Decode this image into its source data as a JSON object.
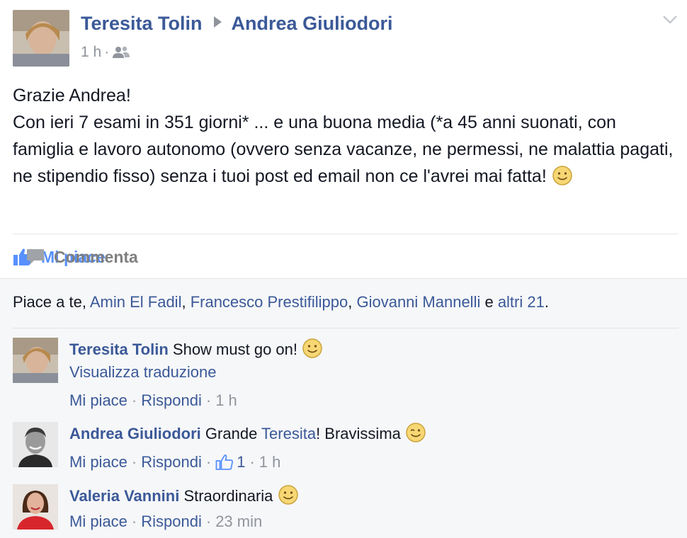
{
  "post": {
    "author": "Teresita Tolin",
    "target": "Andrea Giuliodori",
    "time": "1 h",
    "audience_icon": "friends-icon",
    "menu_icon": "chevron-down-icon",
    "paragraph_1": "Grazie Andrea!",
    "paragraph_2": "Con ieri 7 esami in 351 giorni* ... e una buona media (*a 45 anni suonati, con famiglia e lavoro autonomo (ovvero senza vacanze, ne permessi, ne malattia pagati, ne stipendio fisso) senza i tuoi post ed email non ce l'avrei mai fatta!",
    "emoji": "smile-emoji"
  },
  "actions": {
    "like_label": "Mi piace",
    "comment_label": "Commenta"
  },
  "likes": {
    "prefix": "Piace a te, ",
    "person_1": "Amin El Fadil",
    "sep_1": ", ",
    "person_2": "Francesco Prestifilippo",
    "sep_2": ", ",
    "person_3": "Giovanni Mannelli",
    "conj": " e ",
    "others": "altri 21",
    "suffix": "."
  },
  "comments": [
    {
      "author": "Teresita Tolin",
      "text": "Show must go on!",
      "emoji": "smile-emoji",
      "translate": "Visualizza traduzione",
      "like_label": "Mi piace",
      "reply_label": "Rispondi",
      "time": "1 h"
    },
    {
      "author": "Andrea Giuliodori",
      "text_before": "Grande ",
      "mention": "Teresita",
      "text_after": "! Bravissima",
      "emoji": "wink-emoji",
      "like_label": "Mi piace",
      "reply_label": "Rispondi",
      "like_count": "1",
      "time": "1 h"
    },
    {
      "author": "Valeria Vannini",
      "text": "Straordinaria",
      "emoji": "smile-emoji",
      "like_label": "Mi piace",
      "reply_label": "Rispondi",
      "time": "23 min"
    }
  ],
  "colors": {
    "link": "#3b5998",
    "like_blue": "#5890ff",
    "meta_gray": "#90949c",
    "ufi_bg": "#f6f7f9"
  }
}
